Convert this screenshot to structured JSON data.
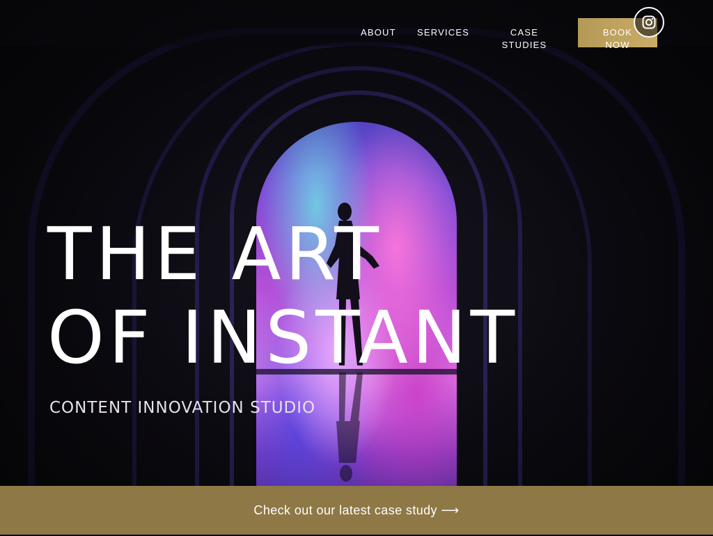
{
  "nav": {
    "about": "ABOUT",
    "services": "SERVICES",
    "case_studies": "CASE STUDIES",
    "book_now": "BOOK NOW",
    "instagram_icon": "instagram-icon"
  },
  "hero": {
    "headline_line1": "THE ART",
    "headline_line2": "OF INSTANT",
    "subtitle": "CONTENT INNOVATION STUDIO"
  },
  "banner": {
    "text": "Check out our latest case study ⟶"
  },
  "colors": {
    "accent_gold": "#c4a662",
    "banner_gold": "#8e7845",
    "background": "#0b0a10"
  }
}
